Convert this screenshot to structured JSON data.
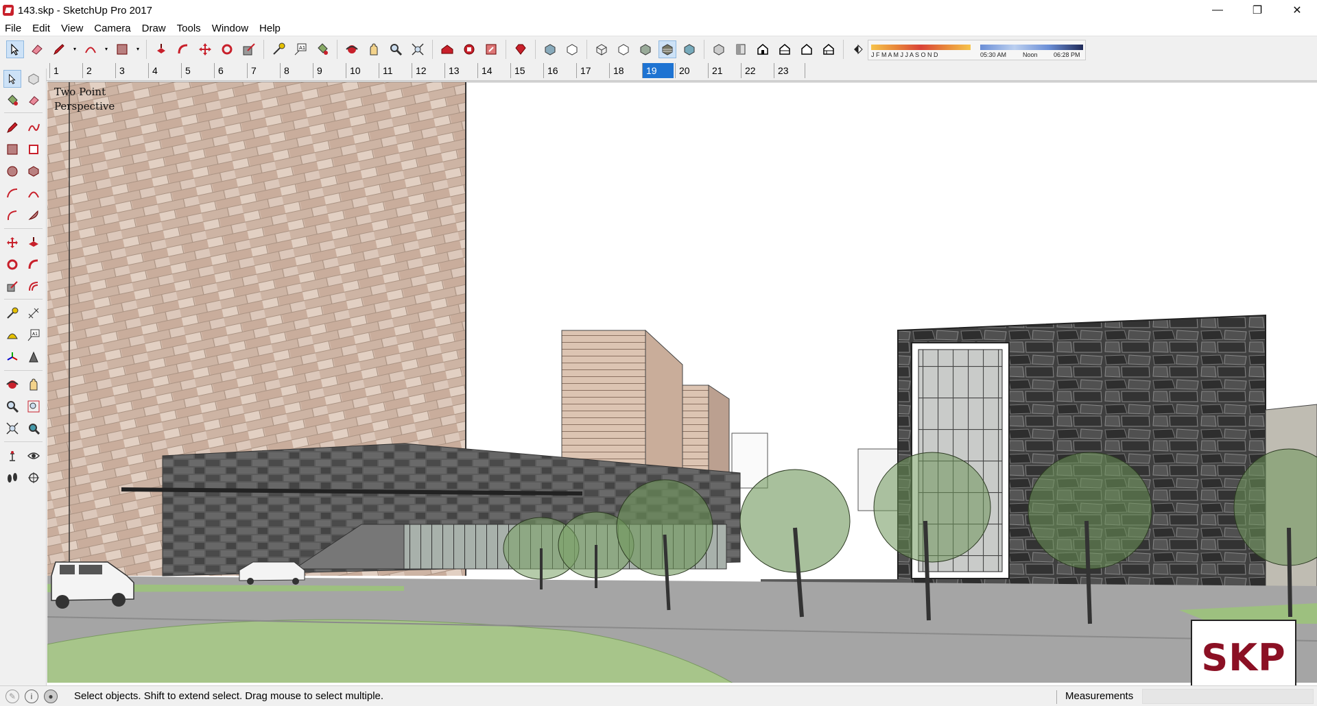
{
  "window": {
    "title": "143.skp - SketchUp Pro 2017"
  },
  "window_controls": {
    "minimize": "—",
    "restore": "❐",
    "close": "✕"
  },
  "menu": [
    "File",
    "Edit",
    "View",
    "Camera",
    "Draw",
    "Tools",
    "Window",
    "Help"
  ],
  "shadow_panel": {
    "months": "J F M A M J J A S O N D",
    "time_start": "05:30 AM",
    "time_noon": "Noon",
    "time_end": "06:28 PM"
  },
  "scene_tabs": [
    "1",
    "2",
    "3",
    "4",
    "5",
    "6",
    "7",
    "8",
    "9",
    "10",
    "11",
    "12",
    "13",
    "14",
    "15",
    "16",
    "17",
    "18",
    "19",
    "20",
    "21",
    "22",
    "23"
  ],
  "selected_scene": "19",
  "viewport": {
    "camera_mode_line1": "Two Point",
    "camera_mode_line2": "Perspective"
  },
  "statusbar": {
    "hint": "Select objects. Shift to extend select. Drag mouse to select multiple.",
    "measurements_label": "Measurements",
    "measurements_value": ""
  },
  "logo": {
    "text": "SKP"
  },
  "colors": {
    "selected_tab": "#1e73d2",
    "logo_red": "#8b1024",
    "sky": "#ffffff",
    "stone_light": "#d8c2b4",
    "stone_dark": "#555555",
    "grass": "#a7c58a"
  },
  "icons": {
    "toolbar": [
      "select-icon",
      "eraser-icon",
      "pencil-icon",
      "arc-icon",
      "rectangle-icon",
      "push-pull-icon",
      "follow-me-icon",
      "move-icon",
      "rotate-icon",
      "scale-icon",
      "tape-measure-icon",
      "text-icon",
      "paint-bucket-icon",
      "orbit-icon",
      "pan-icon",
      "zoom-icon",
      "zoom-extents-icon",
      "warehouse-icon",
      "extension-warehouse-icon",
      "share-model-icon",
      "ruby-icon",
      "xray-icon",
      "back-edges-icon",
      "wireframe-icon",
      "hidden-line-icon",
      "shaded-icon",
      "shaded-textures-icon",
      "monochrome-icon",
      "iso-view-icon",
      "top-view-icon",
      "front-view-icon",
      "right-view-icon",
      "back-view-icon",
      "left-view-icon",
      "shadows-toggle-icon"
    ],
    "left": [
      "select-icon",
      "component-icon",
      "paint-bucket-icon",
      "eraser-icon",
      "line-icon",
      "freehand-icon",
      "rectangle-icon",
      "rotated-rectangle-icon",
      "circle-icon",
      "polygon-icon",
      "arc-icon",
      "two-point-arc-icon",
      "three-point-arc-icon",
      "pie-icon",
      "move-icon",
      "push-pull-icon",
      "rotate-icon",
      "follow-me-icon",
      "scale-icon",
      "offset-icon",
      "tape-measure-icon",
      "dimension-icon",
      "protractor-icon",
      "text-icon",
      "axes-icon",
      "3d-text-icon",
      "orbit-icon",
      "pan-icon",
      "zoom-icon",
      "zoom-window-icon",
      "zoom-extents-icon",
      "previous-view-icon",
      "position-camera-icon",
      "look-around-icon",
      "walk-icon",
      "section-plane-icon"
    ]
  }
}
